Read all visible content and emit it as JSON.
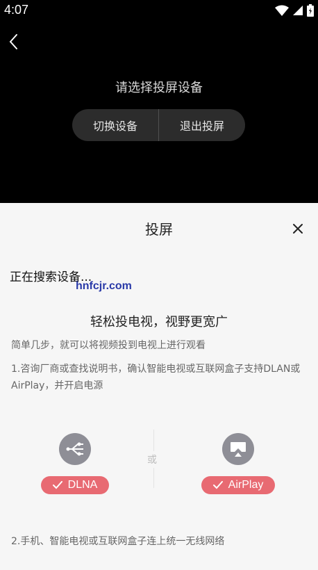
{
  "status_bar": {
    "time": "4:07"
  },
  "header": {
    "title": "请选择投屏设备"
  },
  "actions": {
    "switch_device": "切换设备",
    "exit_cast": "退出投屏"
  },
  "sheet": {
    "title": "投屏",
    "searching_text": "正在搜索设备...",
    "watermark": "hnfcjr.com",
    "promo_title": "轻松投电视，视野更宽广",
    "promo_subtitle": "简单几步，就可以将视频投到电视上进行观看",
    "step1": "1.咨询厂商或查找说明书，确认智能电视或互联网盒子支持DLAN或AirPlay，并开启电源",
    "or_text": "或",
    "protocols": [
      {
        "label": "DLNA",
        "icon": "share-nodes-icon"
      },
      {
        "label": "AirPlay",
        "icon": "airplay-screen-icon"
      }
    ],
    "step2": "2.手机、智能电视或互联网盒子连上统一无线网络"
  },
  "colors": {
    "accent": "#e86a72",
    "icon_gray": "#8e8e96",
    "sheet_bg": "#f6f6f6"
  }
}
